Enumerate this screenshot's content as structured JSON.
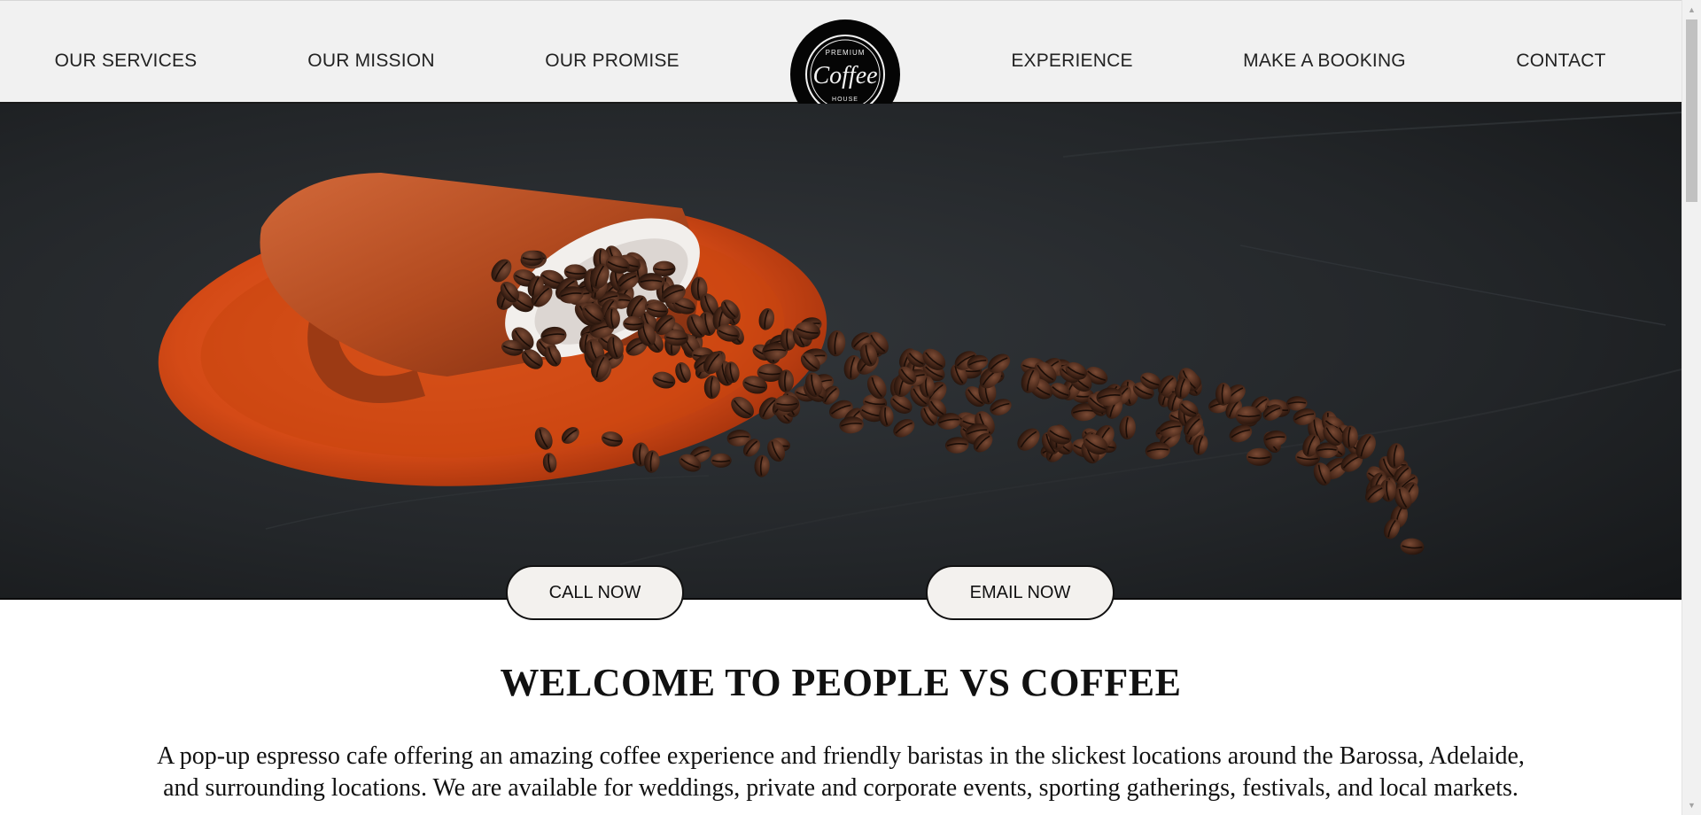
{
  "nav": {
    "left_links": [
      "OUR SERVICES",
      "OUR MISSION",
      "OUR PROMISE"
    ],
    "right_links": [
      "EXPERIENCE",
      "MAKE A BOOKING",
      "CONTACT"
    ],
    "logo": {
      "top_text": "PREMIUM",
      "main_text": "Coffee",
      "bottom_text": "HOUSE"
    }
  },
  "hero": {
    "image": "coffee-cup-spilled-beans",
    "call_label": "CALL NOW",
    "email_label": "EMAIL NOW"
  },
  "welcome": {
    "heading": "WELCOME TO PEOPLE VS COFFEE",
    "line1": "A pop-up espresso cafe offering an amazing coffee experience and friendly baristas in the slickest locations around the Barossa, Adelaide,",
    "line2": "and surrounding locations. We are available for weddings, private and corporate events, sporting gatherings, festivals, and local markets."
  },
  "colors": {
    "nav_bg": "#f1f1f1",
    "hero_bg": "#1e2022",
    "saucer": "#d64a17",
    "cup": "#b9461c",
    "bean": "#3b2116",
    "button_bg": "#f3f1ee"
  },
  "icons": {
    "scroll_up": "triangle-up-icon",
    "scroll_down": "triangle-down-icon"
  }
}
